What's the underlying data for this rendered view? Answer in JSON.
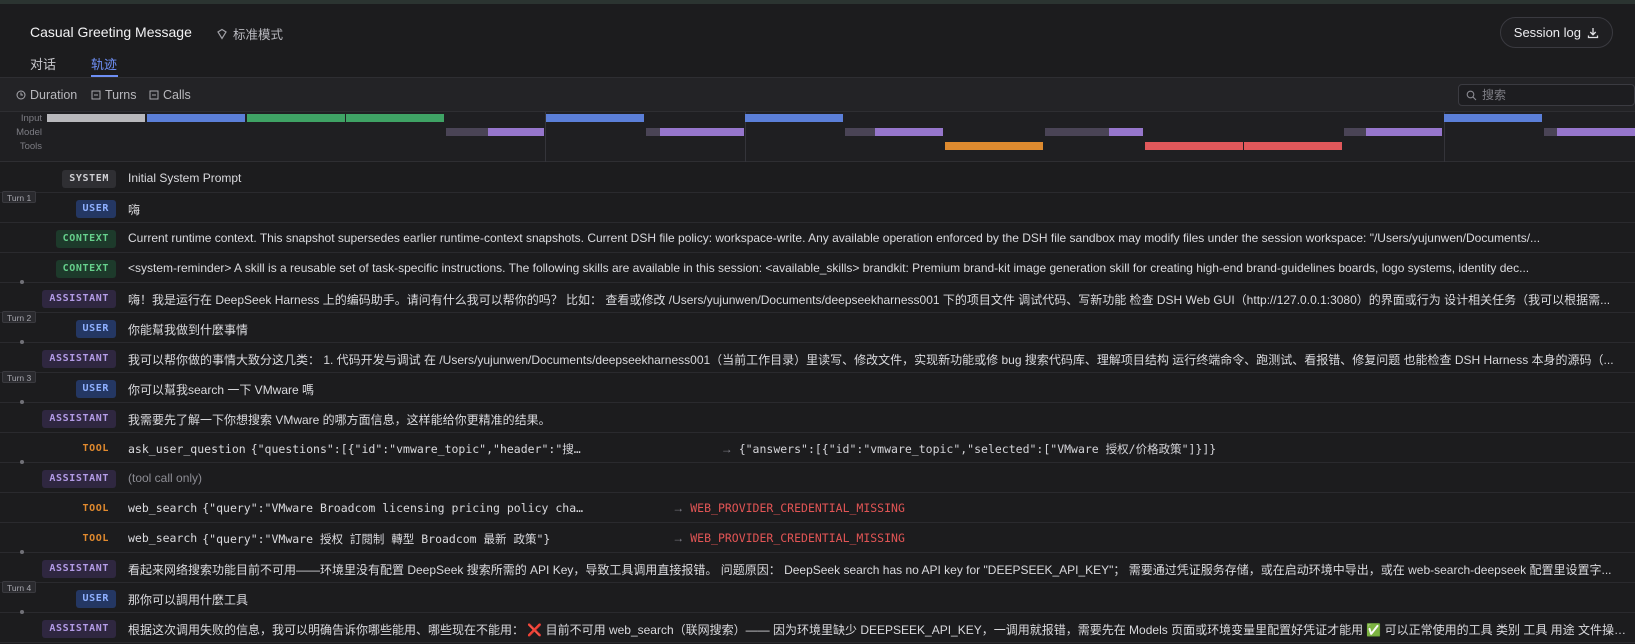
{
  "header": {
    "title": "Casual Greeting Message",
    "mode_label": "标准模式",
    "session_log_label": "Session log",
    "tabs": [
      {
        "label": "对话",
        "active": false
      },
      {
        "label": "轨迹",
        "active": true
      }
    ]
  },
  "toolbar": {
    "duration_label": "Duration",
    "turns_label": "Turns",
    "calls_label": "Calls",
    "search_placeholder": "搜索"
  },
  "timeline": {
    "labels": [
      "Input",
      "Model",
      "Tools"
    ],
    "colors": {
      "system": "#b8b8bc",
      "user": "#5b7fd8",
      "context": "#3fa365",
      "model_wait": "#4a4456",
      "model": "#9676cc",
      "tool_ok": "#dd8a2f",
      "tool_err": "#e0585b"
    }
  },
  "rows": [
    {
      "kind": "SYSTEM",
      "text": "Initial System Prompt"
    },
    {
      "turn": "Turn 1",
      "kind": "USER",
      "text": "嗨"
    },
    {
      "kind": "CONTEXT",
      "text": "Current runtime context. This snapshot supersedes earlier runtime-context snapshots. Current DSH file policy: workspace-write. Any available operation enforced by the DSH file sandbox may modify files under the session workspace: \"/Users/yujunwen/Documents/..."
    },
    {
      "kind": "CONTEXT",
      "text": "<system-reminder> A skill is a reusable set of task-specific instructions. The following skills are available in this session: <available_skills> brandkit: Premium brand-kit image generation skill for creating high-end brand-guidelines boards, logo systems, identity dec..."
    },
    {
      "kind": "ASSISTANT",
      "text": "嗨！我是运行在 DeepSeek Harness 上的编码助手。请问有什么我可以帮你的吗？ 比如： 查看或修改 /Users/yujunwen/Documents/deepseekharness001 下的项目文件 调试代码、写新功能 检查 DSH Web GUI（http://127.0.0.1:3080）的界面或行为 设计相关任务（我可以根据需..."
    },
    {
      "turn": "Turn 2",
      "kind": "USER",
      "text": "你能幫我做到什麼事情"
    },
    {
      "kind": "ASSISTANT",
      "text": "我可以帮你做的事情大致分这几类： 1. 代码开发与调试 在 /Users/yujunwen/Documents/deepseekharness001（当前工作目录）里读写、修改文件，实现新功能或修 bug 搜索代码库、理解项目结构 运行终端命令、跑测试、看报错、修复问题 也能检查 DSH Harness 本身的源码（..."
    },
    {
      "turn": "Turn 3",
      "kind": "USER",
      "text": "你可以幫我search 一下 VMware 嗎"
    },
    {
      "kind": "ASSISTANT",
      "text": "我需要先了解一下你想搜索 VMware 的哪方面信息，这样能给你更精准的结果。"
    },
    {
      "kind": "TOOL",
      "tool": "ask_user_question",
      "args": "{\"questions\":[{\"id\":\"vmware_topic\",\"header\":\"搜…",
      "result": "{\"answers\":[{\"id\":\"vmware_topic\",\"selected\":[\"VMware 授权/价格政策\"]}]}",
      "error": false
    },
    {
      "kind": "ASSISTANT",
      "text": "(tool call only)",
      "muted": true
    },
    {
      "kind": "TOOL",
      "tool": "web_search",
      "args": "{\"query\":\"VMware Broadcom licensing pricing policy cha…",
      "result": "WEB_PROVIDER_CREDENTIAL_MISSING",
      "error": true
    },
    {
      "kind": "TOOL",
      "tool": "web_search",
      "args": "{\"query\":\"VMware 授权 訂閱制 轉型 Broadcom 最新 政策\"}",
      "result": "WEB_PROVIDER_CREDENTIAL_MISSING",
      "error": true
    },
    {
      "kind": "ASSISTANT",
      "text": "看起来网络搜索功能目前不可用——环境里没有配置 DeepSeek 搜索所需的 API Key，导致工具调用直接报错。 问题原因： DeepSeek search has no API key for \"DEEPSEEK_API_KEY\"； 需要通过凭证服务存储，或在启动环境中导出，或在 web-search-deepseek 配置里设置字..."
    },
    {
      "turn": "Turn 4",
      "kind": "USER",
      "text": "那你可以調用什麼工具"
    },
    {
      "kind": "ASSISTANT",
      "text": "根据这次调用失败的信息，我可以明确告诉你哪些能用、哪些现在不能用： ❌ 目前不可用 web_search（联网搜索）—— 因为环境里缺少 DEEPSEEK_API_KEY，一调用就报错，需要先在 Models 页面或环境变量里配置好凭证才能用 ✅ 可以正常使用的工具 类别 工具 用途 文件操作..."
    }
  ]
}
